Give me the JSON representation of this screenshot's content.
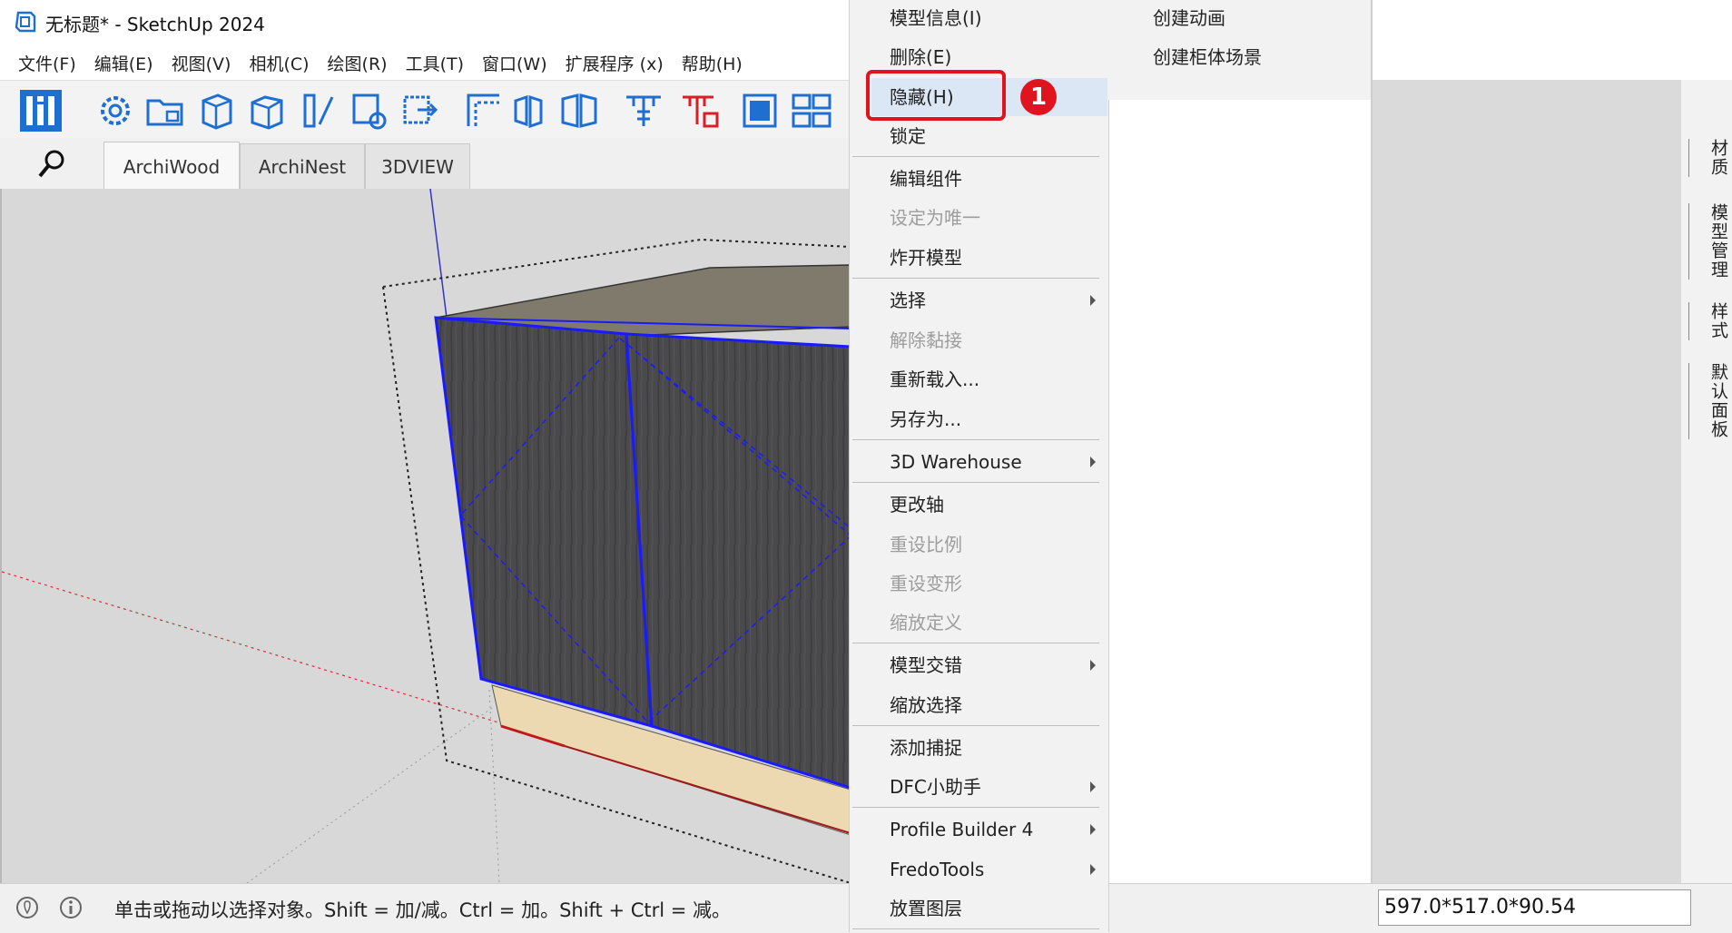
{
  "window": {
    "title": "无标题* - SketchUp 2024",
    "minimize_glyph": "—",
    "maximize_glyph": "☐",
    "close_glyph": "✕"
  },
  "menubar": {
    "items": [
      "文件(F)",
      "编辑(E)",
      "视图(V)",
      "相机(C)",
      "绘图(R)",
      "工具(T)",
      "窗口(W)",
      "扩展程序 (x)",
      "帮助(H)"
    ]
  },
  "toolbar": {
    "icons": [
      "archiwood-logo-icon",
      "settings-icon",
      "open-folder-icon",
      "cabinet-icon",
      "box-icon",
      "panel-icon",
      "rotate-panel-icon",
      "export-icon",
      "frame-icon",
      "split-icon",
      "double-door-icon",
      "hardware-icon",
      "delete-hardware-icon",
      "fill-icon",
      "grid-icon"
    ]
  },
  "ext_tabs": {
    "items": [
      "ArchiWood",
      "ArchiNest",
      "3DVIEW"
    ],
    "active": "ArchiWood"
  },
  "context_menu": {
    "items": [
      {
        "label": "模型信息(I)",
        "disabled": false,
        "submenu": false
      },
      {
        "label": "删除(E)",
        "disabled": false,
        "submenu": false
      },
      {
        "label": "隐藏(H)",
        "disabled": false,
        "submenu": false,
        "highlighted": true
      },
      {
        "label": "锁定",
        "disabled": false,
        "submenu": false
      },
      {
        "label": "编辑组件",
        "disabled": false,
        "submenu": false
      },
      {
        "label": "设定为唯一",
        "disabled": true,
        "submenu": false
      },
      {
        "label": "炸开模型",
        "disabled": false,
        "submenu": false
      },
      {
        "label": "选择",
        "disabled": false,
        "submenu": true
      },
      {
        "label": "解除黏接",
        "disabled": true,
        "submenu": false
      },
      {
        "label": "重新载入...",
        "disabled": false,
        "submenu": false
      },
      {
        "label": "另存为...",
        "disabled": false,
        "submenu": false
      },
      {
        "label": "3D Warehouse",
        "disabled": false,
        "submenu": true
      },
      {
        "label": "更改轴",
        "disabled": false,
        "submenu": false
      },
      {
        "label": "重设比例",
        "disabled": true,
        "submenu": false
      },
      {
        "label": "重设变形",
        "disabled": true,
        "submenu": false
      },
      {
        "label": "缩放定义",
        "disabled": true,
        "submenu": false
      },
      {
        "label": "模型交错",
        "disabled": false,
        "submenu": true
      },
      {
        "label": "缩放选择",
        "disabled": false,
        "submenu": false
      },
      {
        "label": "添加捕捉",
        "disabled": false,
        "submenu": false
      },
      {
        "label": "DFC小助手",
        "disabled": false,
        "submenu": true
      },
      {
        "label": "Profile Builder 4",
        "disabled": false,
        "submenu": true
      },
      {
        "label": "FredoTools",
        "disabled": false,
        "submenu": true
      },
      {
        "label": "放置图层",
        "disabled": false,
        "submenu": false
      }
    ]
  },
  "submenu": {
    "items": [
      "创建动画",
      "创建柜体场景"
    ]
  },
  "step_badge": "1",
  "side_tray": {
    "tabs": [
      "材质",
      "模型管理",
      "样式",
      "默认面板"
    ]
  },
  "statusbar": {
    "message": "单击或拖动以选择对象。Shift = 加/减。Ctrl = 加。Shift + Ctrl = 减。",
    "measurements": "597.0*517.0*90.54"
  },
  "colors": {
    "highlight_red": "#e0141e",
    "hover_blue": "#dce7f5",
    "selection_blue": "#1a1aff",
    "sketchup_blue": "#1f6fd1"
  }
}
